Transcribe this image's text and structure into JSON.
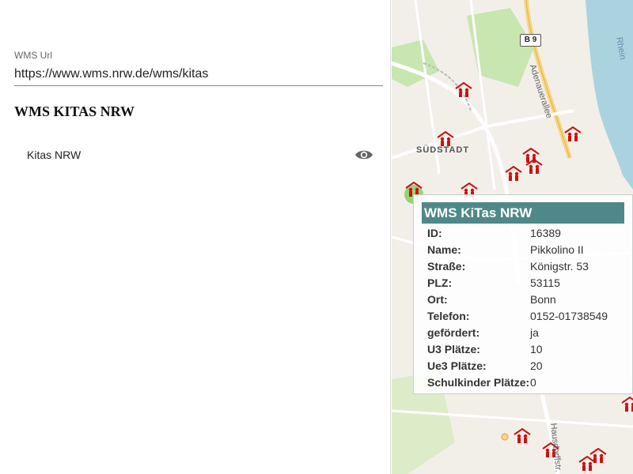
{
  "form": {
    "url_label": "WMS Url",
    "url_value": "https://www.wms.nrw.de/wms/kitas"
  },
  "section": {
    "title": "WMS KITAS NRW"
  },
  "layers": [
    {
      "label": "Kitas NRW",
      "visible": true,
      "icon": "eye-icon"
    }
  ],
  "map": {
    "road_shield": "B 9",
    "district_label": "SÜDSTADT",
    "street_label": "Adenauerallee",
    "river_label": "Rhein",
    "street_label_2": "Hausdorffstr.",
    "marker_color": "#cc1111",
    "water_color": "#aad3df",
    "park_color": "#c8e6b0"
  },
  "popup": {
    "title": "WMS KiTas NRW",
    "rows": [
      {
        "key": "ID:",
        "value": "16389"
      },
      {
        "key": "Name:",
        "value": "Pikkolino II"
      },
      {
        "key": "Straße:",
        "value": "Königstr. 53"
      },
      {
        "key": "PLZ:",
        "value": "53115"
      },
      {
        "key": "Ort:",
        "value": "Bonn"
      },
      {
        "key": "Telefon:",
        "value": "0152-01738549"
      },
      {
        "key": "gefördert:",
        "value": "ja"
      },
      {
        "key": "U3 Plätze:",
        "value": "10"
      },
      {
        "key": "Ue3 Plätze:",
        "value": "20"
      },
      {
        "key": "Schulkinder Plätze:",
        "value": "0"
      }
    ]
  }
}
